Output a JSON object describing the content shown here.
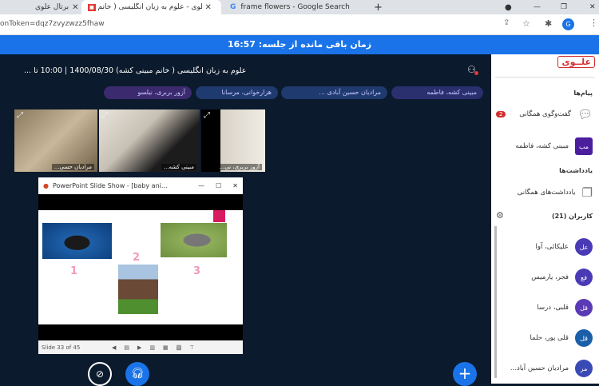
{
  "browser": {
    "tabs": [
      {
        "title": "برتال علوی"
      },
      {
        "title": "علوی - علوم به زبان انگلیسی ( خانم ...",
        "active": true
      },
      {
        "title": "frame flowers - Google Search"
      }
    ],
    "url": "onToken=dqz7zvyzwzz5fhaw",
    "profile_initial": "G"
  },
  "banner": {
    "text": "زمان باقی مانده از جلسه: 16:57"
  },
  "session": {
    "title": "علوم به زبان انگلیسی ( خانم مبینی کشه) 1400/08/30 | 10:00 تا ...",
    "chips": [
      {
        "name": "مبینی کشه، فاطمه",
        "color": "#2a2f6e"
      },
      {
        "name": "مرادیان حسین آبادی ...",
        "color": "#1f3a6e"
      },
      {
        "name": "هزارخوانی، مرسانا",
        "color": "#1f3a6e"
      },
      {
        "name": "آزور بربری، نیلسو",
        "color": "#3b2a6e"
      }
    ],
    "videos": [
      {
        "name": "مرادیان حسی..."
      },
      {
        "name": "مبینی کشه..."
      },
      {
        "name": "آزور بربری، نی..."
      }
    ]
  },
  "slideshow": {
    "title": "PowerPoint Slide Show - [baby ani...",
    "labels": [
      "1",
      "2",
      "3"
    ],
    "status": "Slide 33 of 45",
    "accent": "#d81b60"
  },
  "sidebar": {
    "logo": "علــوی",
    "messages_heading": "پیام‌ها",
    "public_chat": "گفت‌وگوی همگانی",
    "chat_badge": "2",
    "private_chat": {
      "initials": "مب",
      "name": "مبینی کشه، فاطمه"
    },
    "notes_heading": "یادداشت‌ها",
    "public_notes": "یادداشت‌های همگانی",
    "users_heading": "کاربران (21)",
    "users": [
      {
        "initials": "عل",
        "name": "علیکائی، آوا",
        "color": "#4a3ab5"
      },
      {
        "initials": "فع",
        "name": "فجر، یارمیس",
        "color": "#4a3ab5"
      },
      {
        "initials": "قل",
        "name": "قلبی، درسا",
        "color": "#5b3ab5"
      },
      {
        "initials": "قل",
        "name": "قلی پور، حلما",
        "color": "#1a5fa8"
      },
      {
        "initials": "مر",
        "name": "مرادیان حسین آباد...",
        "color": "#3a4ab5"
      }
    ]
  }
}
